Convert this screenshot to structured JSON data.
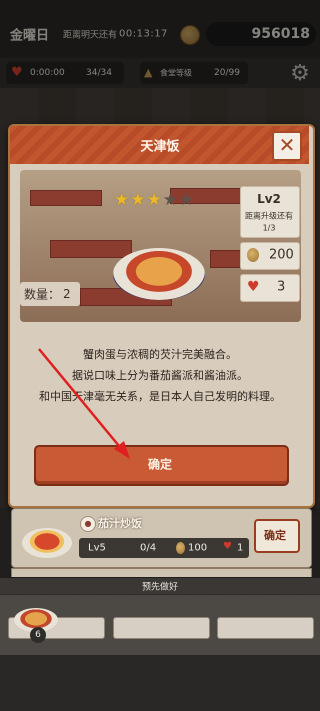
{
  "status_bar": {
    "weekday": "金曜日",
    "countdown_label": "距离明天还有",
    "countdown_time": "00:13:17",
    "coins": "956018"
  },
  "stats": {
    "heart_timer": "0:00:00",
    "heart_count": "34/34",
    "cafeteria_label": "食堂等级",
    "cafeteria_level": "20/99"
  },
  "dish_modal": {
    "title": "天津饭",
    "stars_filled": 3,
    "stars_total": 5,
    "level": "Lv2",
    "upgrade_label": "距离升级还有",
    "upgrade_progress": "1/3",
    "price": "200",
    "heart_cost": "3",
    "quantity_label": "数量：",
    "quantity": "2",
    "description": [
      "蟹肉蛋与浓稠的芡汁完美融合。",
      "据说口味上分为番茄酱派和酱油派。",
      "和中国天津毫无关系，是日本人自己发明的料理。"
    ],
    "confirm_label": "确定"
  },
  "dish_list": [
    {
      "name": "茄汁炒饭",
      "level": "Lv5",
      "quantity": "0/4",
      "price": "100",
      "heart_cost": "1",
      "confirm_label": "确定"
    }
  ],
  "prepared": {
    "label": "预先做好",
    "count": "6"
  },
  "colors": {
    "accent": "#c85a36",
    "modal_bg": "#d8cdbd",
    "star": "#e8b92c",
    "arrow": "#e02020"
  }
}
